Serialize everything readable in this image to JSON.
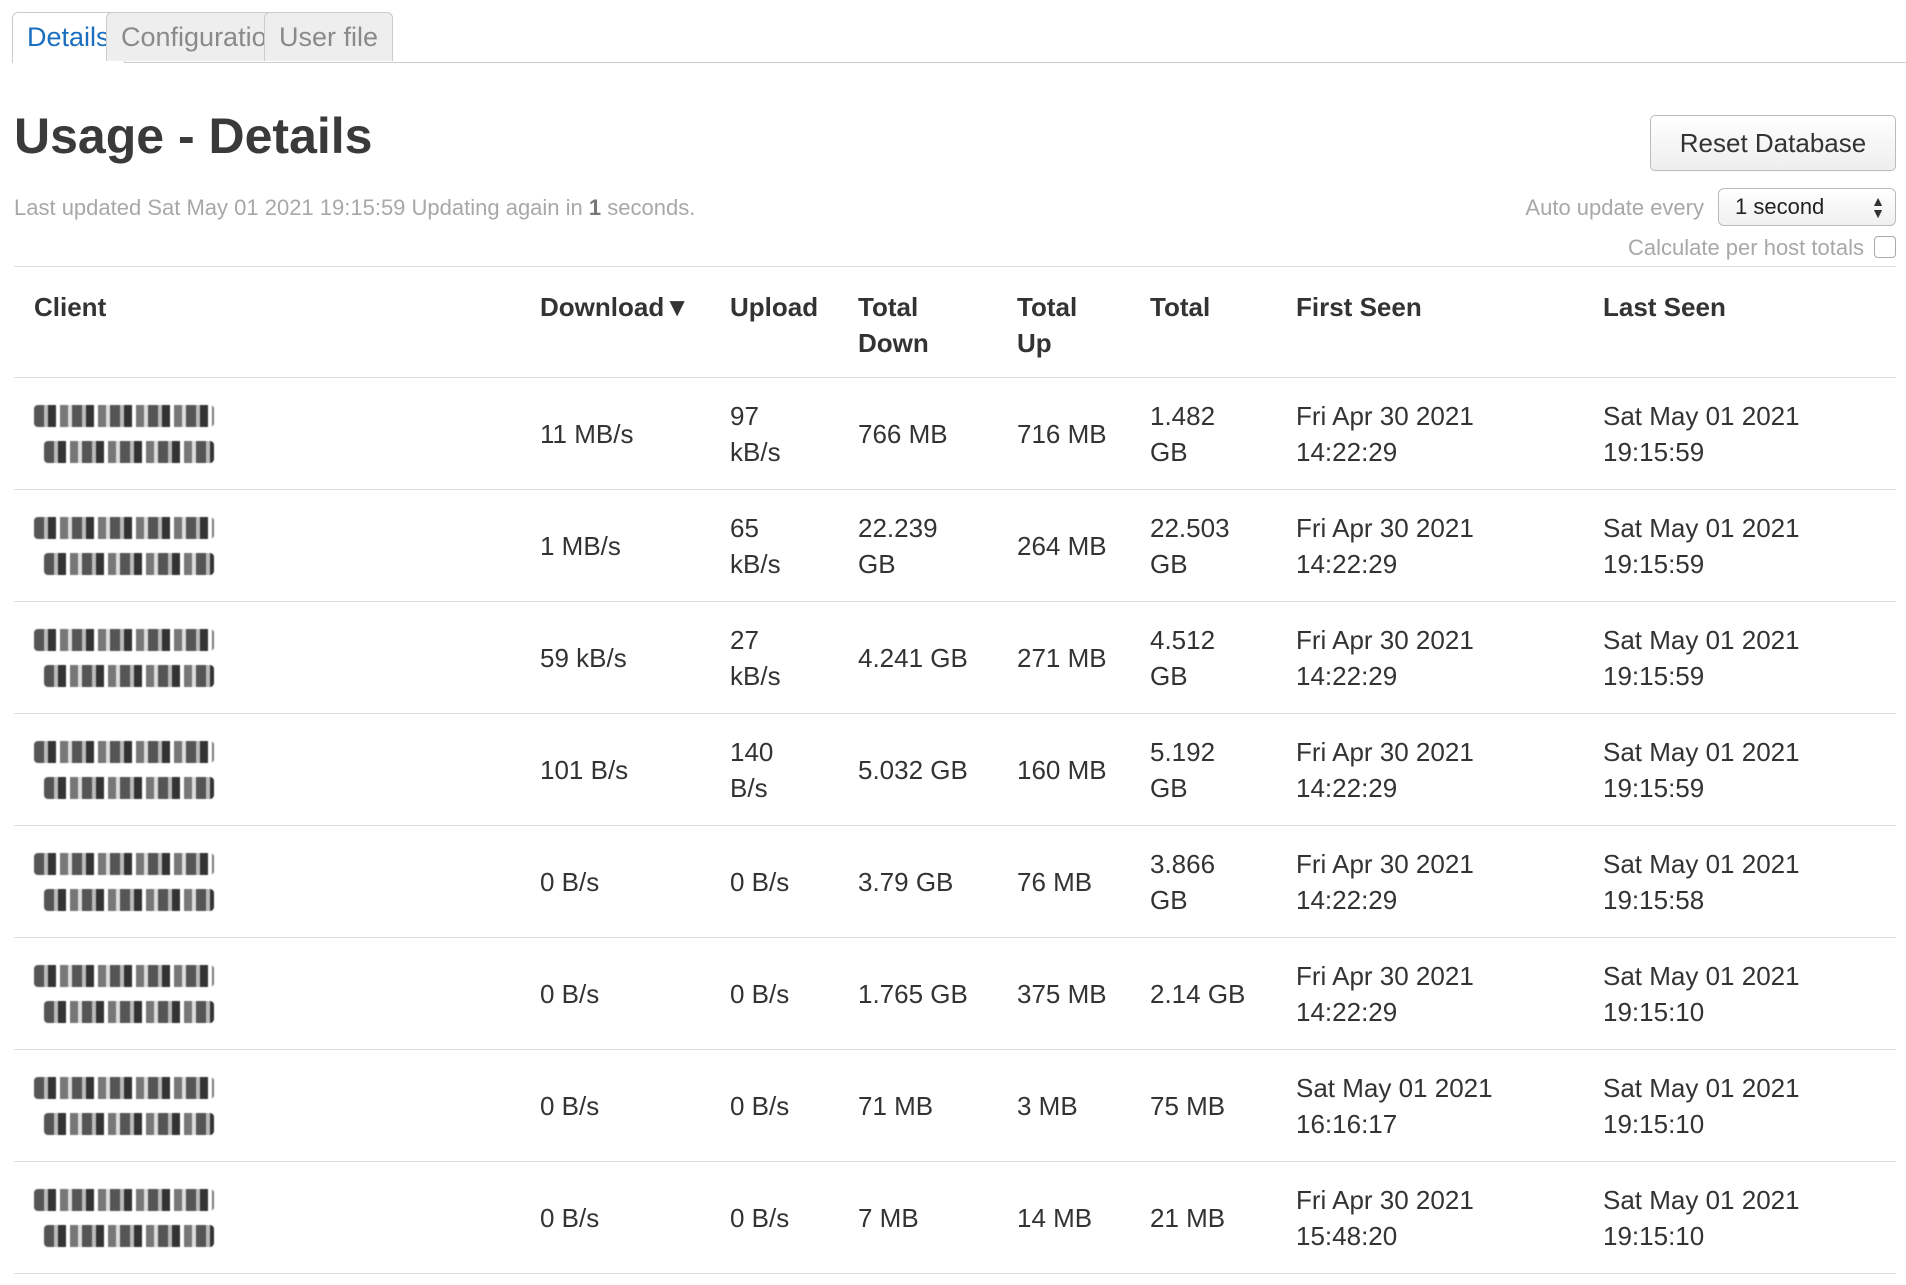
{
  "tabs": [
    {
      "label": "Details",
      "active": true
    },
    {
      "label": "Configuration",
      "active": false
    },
    {
      "label": "User file",
      "active": false
    }
  ],
  "header": {
    "title": "Usage - Details",
    "reset_label": "Reset Database",
    "updated_prefix": "Last updated Sat May 01 2021 19:15:59 Updating again in ",
    "updated_seconds": "1",
    "updated_suffix": " seconds.",
    "auto_update_label": "Auto update every",
    "auto_update_value": "1 second",
    "per_host_label": "Calculate per host totals"
  },
  "colors": {
    "tab_active": "#1a6fc0",
    "muted_text": "#a8a8a8"
  },
  "table": {
    "columns": {
      "client": "Client",
      "download": "Download",
      "sort_indicator": "▼",
      "upload": "Upload",
      "total_down_1": "Total",
      "total_down_2": "Down",
      "total_up_1": "Total",
      "total_up_2": "Up",
      "total": "Total",
      "first_seen": "First Seen",
      "last_seen": "Last Seen"
    },
    "rows": [
      {
        "download": "11 MB/s",
        "upload_1": "97",
        "upload_2": "kB/s",
        "total_down_1": "766 MB",
        "total_down_2": "",
        "total_up": "716 MB",
        "total_1": "1.482",
        "total_2": "GB",
        "first_1": "Fri Apr 30 2021",
        "first_2": "14:22:29",
        "last_1": "Sat May 01 2021",
        "last_2": "19:15:59"
      },
      {
        "download": "1 MB/s",
        "upload_1": "65",
        "upload_2": "kB/s",
        "total_down_1": "22.239",
        "total_down_2": "GB",
        "total_up": "264 MB",
        "total_1": "22.503",
        "total_2": "GB",
        "first_1": "Fri Apr 30 2021",
        "first_2": "14:22:29",
        "last_1": "Sat May 01 2021",
        "last_2": "19:15:59"
      },
      {
        "download": "59 kB/s",
        "upload_1": "27",
        "upload_2": "kB/s",
        "total_down_1": "4.241 GB",
        "total_down_2": "",
        "total_up": "271 MB",
        "total_1": "4.512",
        "total_2": "GB",
        "first_1": "Fri Apr 30 2021",
        "first_2": "14:22:29",
        "last_1": "Sat May 01 2021",
        "last_2": "19:15:59"
      },
      {
        "download": "101 B/s",
        "upload_1": "140",
        "upload_2": "B/s",
        "total_down_1": "5.032 GB",
        "total_down_2": "",
        "total_up": "160 MB",
        "total_1": "5.192",
        "total_2": "GB",
        "first_1": "Fri Apr 30 2021",
        "first_2": "14:22:29",
        "last_1": "Sat May 01 2021",
        "last_2": "19:15:59"
      },
      {
        "download": "0 B/s",
        "upload_1": "0 B/s",
        "upload_2": "",
        "total_down_1": "3.79 GB",
        "total_down_2": "",
        "total_up": "76 MB",
        "total_1": "3.866",
        "total_2": "GB",
        "first_1": "Fri Apr 30 2021",
        "first_2": "14:22:29",
        "last_1": "Sat May 01 2021",
        "last_2": "19:15:58"
      },
      {
        "download": "0 B/s",
        "upload_1": "0 B/s",
        "upload_2": "",
        "total_down_1": "1.765 GB",
        "total_down_2": "",
        "total_up": "375 MB",
        "total_1": "2.14 GB",
        "total_2": "",
        "first_1": "Fri Apr 30 2021",
        "first_2": "14:22:29",
        "last_1": "Sat May 01 2021",
        "last_2": "19:15:10"
      },
      {
        "download": "0 B/s",
        "upload_1": "0 B/s",
        "upload_2": "",
        "total_down_1": "71 MB",
        "total_down_2": "",
        "total_up": "3 MB",
        "total_1": "75 MB",
        "total_2": "",
        "first_1": "Sat May 01 2021",
        "first_2": "16:16:17",
        "last_1": "Sat May 01 2021",
        "last_2": "19:15:10"
      },
      {
        "download": "0 B/s",
        "upload_1": "0 B/s",
        "upload_2": "",
        "total_down_1": "7 MB",
        "total_down_2": "",
        "total_up": "14 MB",
        "total_1": "21 MB",
        "total_2": "",
        "first_1": "Fri Apr 30 2021",
        "first_2": "15:48:20",
        "last_1": "Sat May 01 2021",
        "last_2": "19:15:10"
      }
    ]
  }
}
